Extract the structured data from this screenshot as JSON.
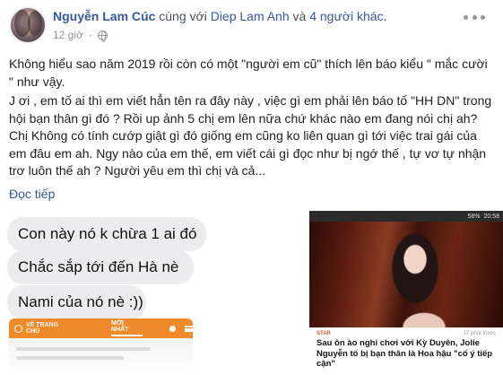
{
  "post": {
    "author": "Nguyễn Lam Cúc",
    "with_text": " cùng với ",
    "tagged_person": "Diep Lam Anh",
    "and_text": " và ",
    "others": "4 người khác",
    "period": ".",
    "time": "12 giờ",
    "privacy_icon": "globe-icon",
    "more_icon": "more-options-icon",
    "paragraphs": [
      "Không hiểu sao năm 2019 rồi còn có một \"người em cũ\" thích lên báo kiểu \" mắc cười \" như vậy.",
      "J ơi , em tố ai thì em viết hẳn tên ra đây này , việc gì em phải lên báo tố \"HH DN\" trong hội bạn thân gì đó ? Rồi up ảnh 5 chị em lên nữa chứ khác nào em đang nói chị ah? Chị Không có tính cướp giật gì đó giống em cũng ko liên quan gì tới việc trai gái của em đâu em ah. Ngy nào của em thế, em viết cái gì đọc như bị ngớ thế , tự vơ tự nhận trơ luôn thế ah ? Người yêu em thì chị và cả..."
    ],
    "read_more": "Đọc tiếp"
  },
  "chat_image": {
    "messages": [
      "Con này nó k chừa 1 ai đó",
      "Chắc sắp tới đến Hà nè",
      "Nami của nó nè :))"
    ],
    "app_bar": {
      "home": "VỀ TRANG CHỦ",
      "newest": "MỚI NHẤT"
    },
    "colors": {
      "app_bar": "#ef8a2a",
      "bubble": "#ececee"
    }
  },
  "news_image": {
    "status_bar": "20:58",
    "battery": "58%",
    "tag": "STAR",
    "time": "17 phút trước",
    "title": "Sau ồn ào nghi chơi với Kỳ Duyên, Jolie Nguyễn tố bị bạn thân là Hoa hậu \"cố ý tiếp cận\""
  }
}
